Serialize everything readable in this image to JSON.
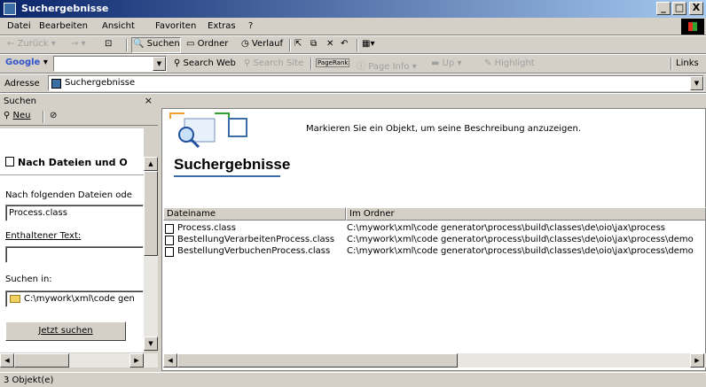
{
  "window": {
    "title": "Suchergebnisse",
    "minimize": "_",
    "maximize": "□",
    "close": "X"
  },
  "menu": [
    "Datei",
    "Bearbeiten",
    "Ansicht",
    "Favoriten",
    "Extras",
    "?"
  ],
  "toolbar": {
    "back": "Zurück",
    "search": "Suchen",
    "folders": "Ordner",
    "history": "Verlauf"
  },
  "google": {
    "brand": "Google",
    "search_web": "Search Web",
    "search_site": "Search Site",
    "pagerank": "PageRank",
    "page_info": "Page Info",
    "up": "Up",
    "highlight": "Highlight",
    "links": "Links"
  },
  "address": {
    "label": "Adresse",
    "value": "Suchergebnisse"
  },
  "search_pane": {
    "title": "Suchen",
    "close": "×",
    "new": "Neu",
    "heading": "Nach Dateien und O",
    "files_label": "Nach folgenden Dateien ode",
    "files_value": "Process.class",
    "text_label": "Enthaltener Text:",
    "text_value": "",
    "look_in_label": "Suchen in:",
    "look_in_value": "C:\\mywork\\xml\\code gen",
    "search_button": "Jetzt suchen"
  },
  "results": {
    "message": "Markieren Sie ein Objekt, um seine Beschreibung anzuzeigen.",
    "title": "Suchergebnisse",
    "columns": [
      "Dateiname",
      "Im Ordner"
    ],
    "rows": [
      {
        "name": "Process.class",
        "folder": "C:\\mywork\\xml\\code generator\\process\\build\\classes\\de\\oio\\jax\\process"
      },
      {
        "name": "BestellungVerarbeitenProcess.class",
        "folder": "C:\\mywork\\xml\\code generator\\process\\build\\classes\\de\\oio\\jax\\process\\demo"
      },
      {
        "name": "BestellungVerbuchenProcess.class",
        "folder": "C:\\mywork\\xml\\code generator\\process\\build\\classes\\de\\oio\\jax\\process\\demo"
      }
    ]
  },
  "status": {
    "text": "3 Objekt(e)"
  }
}
